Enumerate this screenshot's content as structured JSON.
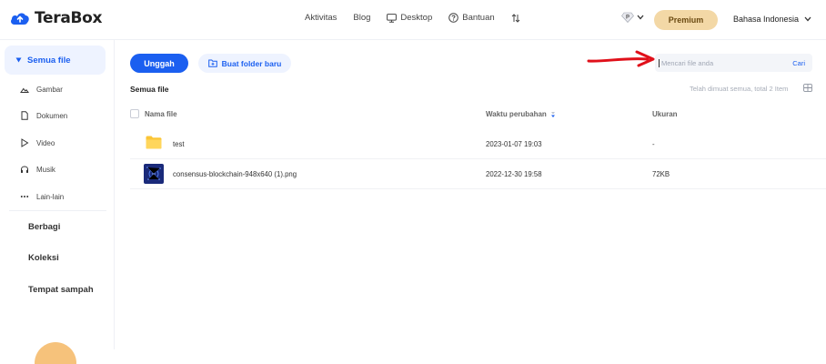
{
  "app": {
    "name": "TeraBox",
    "brand_color": "#1b5ff0",
    "premium_color": "#f3d8a6"
  },
  "topnav": {
    "items": [
      {
        "label": "Aktivitas",
        "icon": ""
      },
      {
        "label": "Blog",
        "icon": ""
      },
      {
        "label": "Desktop",
        "icon": "monitor-icon"
      },
      {
        "label": "Bantuan",
        "icon": "help-circle-icon"
      }
    ],
    "sort_icon": "sort-arrows-icon",
    "vip_badge": "P",
    "premium_label": "Premium",
    "language": "Bahasa Indonesia"
  },
  "sidebar": {
    "active": {
      "label": "Semua file",
      "icon": "caret-down-icon"
    },
    "subitems": [
      {
        "label": "Gambar",
        "icon": "image-icon"
      },
      {
        "label": "Dokumen",
        "icon": "document-icon"
      },
      {
        "label": "Video",
        "icon": "play-icon"
      },
      {
        "label": "Musik",
        "icon": "headphones-icon"
      },
      {
        "label": "Lain-lain",
        "icon": "more-dots-icon"
      }
    ],
    "main_items": [
      {
        "label": "Berbagi"
      },
      {
        "label": "Koleksi"
      },
      {
        "label": "Tempat sampah"
      }
    ]
  },
  "toolbar": {
    "upload_label": "Unggah",
    "new_folder_label": "Buat folder baru"
  },
  "search": {
    "placeholder": "Mencari file anda",
    "button_label": "Cari"
  },
  "breadcrumb": "Semua file",
  "loaded_text": "Telah dimuat semua, total 2 Item",
  "table": {
    "columns": {
      "name": "Nama file",
      "modified": "Waktu perubahan",
      "size": "Ukuran"
    },
    "rows": [
      {
        "name": "test",
        "modified": "2023-01-07 19:03",
        "size": "-",
        "icon": "folder-icon"
      },
      {
        "name": "consensus-blockchain-948x640 (1).png",
        "modified": "2022-12-30 19:58",
        "size": "72KB",
        "icon": "image-thumbnail-icon"
      }
    ]
  }
}
